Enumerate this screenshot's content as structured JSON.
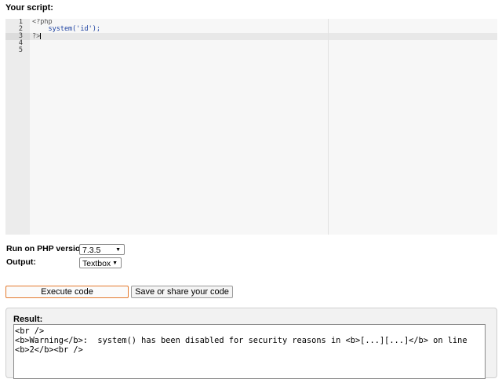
{
  "page": {
    "script_title": "Your script:"
  },
  "editor": {
    "line_numbers": [
      "1",
      "2",
      "3",
      "4",
      "5"
    ],
    "active_line": 3,
    "lines": [
      "<?php",
      "    system('id');",
      "?>",
      "",
      ""
    ]
  },
  "options": {
    "php_version_label": "Run on PHP version:",
    "php_version_value": "7.3.5",
    "output_label": "Output:",
    "output_value": "Textbox"
  },
  "buttons": {
    "execute": "Execute code",
    "save_share": "Save or share your code"
  },
  "result": {
    "title": "Result:",
    "text": "<br />\n<b>Warning</b>:  system() has been disabled for security reasons in <b>[...][...]</b> on line\n<b>2</b><br />"
  },
  "colors": {
    "execute_border": "#e47a2e"
  }
}
